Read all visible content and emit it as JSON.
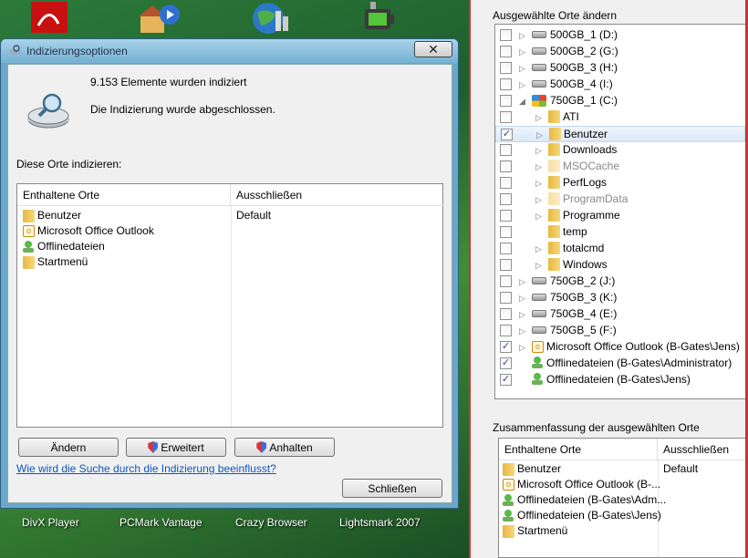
{
  "desktop": {
    "labels": [
      "DivX Player",
      "PCMark Vantage",
      "Crazy Browser",
      "Lightsmark 2007"
    ]
  },
  "indexing_window": {
    "title": "Indizierungsoptionen",
    "close_symbol": "✕",
    "items_indexed": "9.153 Elemente wurden indiziert",
    "status": "Die Indizierung wurde abgeschlossen.",
    "section_label": "Diese Orte indizieren:",
    "columns": {
      "included": "Enthaltene Orte",
      "excluded": "Ausschließen"
    },
    "rows": [
      {
        "name": "Benutzer",
        "icon": "folder-icon",
        "exclude": "Default"
      },
      {
        "name": "Microsoft Office Outlook",
        "icon": "outlook-icon",
        "exclude": ""
      },
      {
        "name": "Offlinedateien",
        "icon": "offline-files-icon",
        "exclude": ""
      },
      {
        "name": "Startmenü",
        "icon": "folder-icon",
        "exclude": ""
      }
    ],
    "buttons": {
      "change": "Ändern",
      "advanced": "Erweitert",
      "pause": "Anhalten",
      "close": "Schließen"
    },
    "help_link": "Wie wird die Suche durch die Indizierung beeinflusst?"
  },
  "locations_panel": {
    "title": "Ausgewählte Orte ändern",
    "tree": [
      {
        "label": "500GB_1 (D:)",
        "checked": false,
        "level": 0,
        "icon": "drive-icon",
        "expander": "▷",
        "grey": false,
        "selected": false
      },
      {
        "label": "500GB_2 (G:)",
        "checked": false,
        "level": 0,
        "icon": "drive-icon",
        "expander": "▷",
        "grey": false,
        "selected": false
      },
      {
        "label": "500GB_3 (H:)",
        "checked": false,
        "level": 0,
        "icon": "drive-icon",
        "expander": "▷",
        "grey": false,
        "selected": false
      },
      {
        "label": "500GB_4 (I:)",
        "checked": false,
        "level": 0,
        "icon": "drive-icon",
        "expander": "▷",
        "grey": false,
        "selected": false
      },
      {
        "label": "750GB_1 (C:)",
        "checked": false,
        "level": 0,
        "icon": "windows-drive-icon",
        "expander": "◢",
        "grey": false,
        "selected": false
      },
      {
        "label": "ATI",
        "checked": false,
        "level": 1,
        "icon": "folder-icon",
        "expander": "▷",
        "grey": false,
        "selected": false
      },
      {
        "label": "Benutzer",
        "checked": true,
        "level": 1,
        "icon": "folder-icon",
        "expander": "▷",
        "grey": false,
        "selected": true
      },
      {
        "label": "Downloads",
        "checked": false,
        "level": 1,
        "icon": "folder-icon",
        "expander": "▷",
        "grey": false,
        "selected": false
      },
      {
        "label": "MSOCache",
        "checked": false,
        "level": 1,
        "icon": "folder-icon",
        "expander": "▷",
        "grey": true,
        "selected": false
      },
      {
        "label": "PerfLogs",
        "checked": false,
        "level": 1,
        "icon": "folder-icon",
        "expander": "▷",
        "grey": false,
        "selected": false
      },
      {
        "label": "ProgramData",
        "checked": false,
        "level": 1,
        "icon": "folder-icon",
        "expander": "▷",
        "grey": true,
        "selected": false
      },
      {
        "label": "Programme",
        "checked": false,
        "level": 1,
        "icon": "folder-icon",
        "expander": "▷",
        "grey": false,
        "selected": false
      },
      {
        "label": "temp",
        "checked": false,
        "level": 1,
        "icon": "folder-icon",
        "expander": "",
        "grey": false,
        "selected": false
      },
      {
        "label": "totalcmd",
        "checked": false,
        "level": 1,
        "icon": "folder-icon",
        "expander": "▷",
        "grey": false,
        "selected": false
      },
      {
        "label": "Windows",
        "checked": false,
        "level": 1,
        "icon": "folder-icon",
        "expander": "▷",
        "grey": false,
        "selected": false
      },
      {
        "label": "750GB_2 (J:)",
        "checked": false,
        "level": 0,
        "icon": "drive-icon",
        "expander": "▷",
        "grey": false,
        "selected": false
      },
      {
        "label": "750GB_3 (K:)",
        "checked": false,
        "level": 0,
        "icon": "drive-icon",
        "expander": "▷",
        "grey": false,
        "selected": false
      },
      {
        "label": "750GB_4 (E:)",
        "checked": false,
        "level": 0,
        "icon": "drive-icon",
        "expander": "▷",
        "grey": false,
        "selected": false
      },
      {
        "label": "750GB_5 (F:)",
        "checked": false,
        "level": 0,
        "icon": "drive-icon",
        "expander": "▷",
        "grey": false,
        "selected": false
      },
      {
        "label": "Microsoft Office Outlook (B-Gates\\Jens)",
        "checked": true,
        "level": 0,
        "icon": "outlook-icon",
        "expander": "▷",
        "grey": false,
        "selected": false
      },
      {
        "label": "Offlinedateien (B-Gates\\Administrator)",
        "checked": true,
        "level": 0,
        "icon": "offline-files-icon",
        "expander": "",
        "grey": false,
        "selected": false
      },
      {
        "label": "Offlinedateien (B-Gates\\Jens)",
        "checked": true,
        "level": 0,
        "icon": "offline-files-icon",
        "expander": "",
        "grey": false,
        "selected": false
      }
    ]
  },
  "summary_panel": {
    "title": "Zusammenfassung der ausgewählten Orte",
    "columns": {
      "included": "Enthaltene Orte",
      "excluded": "Ausschließen"
    },
    "rows": [
      {
        "name": "Benutzer",
        "icon": "folder-icon",
        "exclude": "Default"
      },
      {
        "name": "Microsoft Office Outlook (B-...",
        "icon": "outlook-icon",
        "exclude": ""
      },
      {
        "name": "Offlinedateien (B-Gates\\Adm...",
        "icon": "offline-files-icon",
        "exclude": ""
      },
      {
        "name": "Offlinedateien (B-Gates\\Jens)",
        "icon": "offline-files-icon",
        "exclude": ""
      },
      {
        "name": "Startmenü",
        "icon": "folder-icon",
        "exclude": ""
      }
    ]
  },
  "check_mark": "✓"
}
